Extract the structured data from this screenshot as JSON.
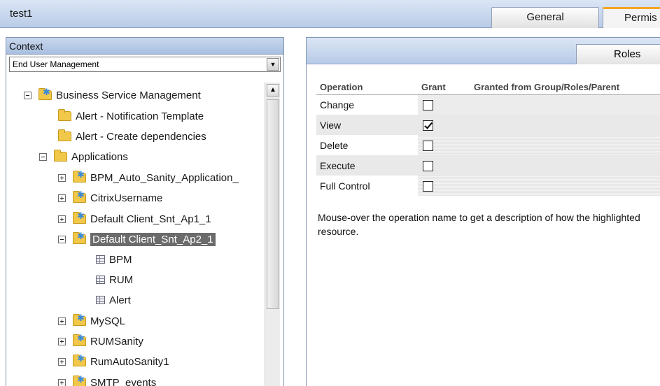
{
  "window": {
    "title": "test1"
  },
  "tabs": {
    "general": "General",
    "permissions": "Permis"
  },
  "context": {
    "header": "Context",
    "selected": "End User Management",
    "tree": [
      {
        "label": "Business Service Management",
        "icon": "folder-star"
      },
      {
        "label": "Alert - Notification Template",
        "icon": "folder"
      },
      {
        "label": "Alert - Create dependencies",
        "icon": "folder"
      },
      {
        "label": "Applications",
        "icon": "folder"
      },
      {
        "label": "BPM_Auto_Sanity_Application_",
        "icon": "folder-star"
      },
      {
        "label": "CitrixUsername",
        "icon": "folder-star"
      },
      {
        "label": "Default Client_Snt_Ap1_1",
        "icon": "folder-star"
      },
      {
        "label": "Default Client_Snt_Ap2_1",
        "icon": "folder-star",
        "selected": true
      },
      {
        "label": "BPM",
        "icon": "grid"
      },
      {
        "label": "RUM",
        "icon": "grid"
      },
      {
        "label": "Alert",
        "icon": "grid"
      },
      {
        "label": "MySQL",
        "icon": "folder-star"
      },
      {
        "label": "RUMSanity",
        "icon": "folder-star"
      },
      {
        "label": "RumAutoSanity1",
        "icon": "folder-star"
      },
      {
        "label": "SMTP_events",
        "icon": "folder-star"
      }
    ]
  },
  "permissions": {
    "roles_tab": "Roles",
    "columns": {
      "operation": "Operation",
      "grant": "Grant",
      "granted_from": "Granted from Group/Roles/Parent"
    },
    "operations": [
      {
        "name": "Change",
        "granted": false
      },
      {
        "name": "View",
        "granted": true
      },
      {
        "name": "Delete",
        "granted": false
      },
      {
        "name": "Execute",
        "granted": false
      },
      {
        "name": "Full Control",
        "granted": false
      }
    ],
    "help_text": "Mouse-over the operation name to get a description of how the highlighted resource."
  }
}
